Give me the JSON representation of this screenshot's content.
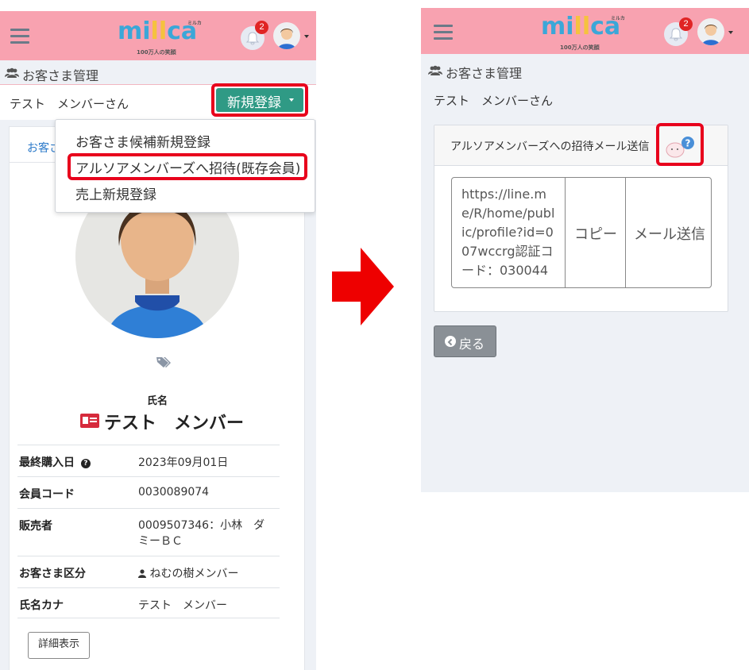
{
  "left": {
    "logo": {
      "text": "millca",
      "sub": "100万人の笑顔",
      "tag": "ミルカ"
    },
    "notification_count": "2",
    "breadcrumb": "お客さま管理",
    "customer_title": "テスト　メンバーさん",
    "new_button_label": "新規登録",
    "dropdown": {
      "items": [
        "お客さま候補新規登録",
        "アルソアメンバーズへ招待(既存会員)",
        "売上新規登録"
      ]
    },
    "card_tab": "お客さ",
    "name_caption": "氏名",
    "name": "テスト　メンバー",
    "rows": [
      {
        "label": "最終購入日",
        "value": "2023年09月01日"
      },
      {
        "label": "会員コード",
        "value": "0030089074"
      },
      {
        "label": "販売者",
        "value": "0009507346：小林　ダミーＢＣ"
      },
      {
        "label": "お客さま区分",
        "value": "ねむの樹メンバー"
      },
      {
        "label": "氏名カナ",
        "value": "テスト　メンバー"
      }
    ],
    "detail_button": "詳細表示"
  },
  "right": {
    "logo": {
      "text": "millca",
      "sub": "100万人の笑顔",
      "tag": "ミルカ"
    },
    "notification_count": "2",
    "breadcrumb": "お客さま管理",
    "customer_title": "テスト　メンバーさん",
    "invite_title": "アルソアメンバーズへの招待メール送信",
    "invite_text": "https://line.me/R/home/public/profile?id=007wccrg認証コード：030044",
    "copy_button": "コピー",
    "mail_button": "メール送信",
    "back_button": "戻る"
  },
  "colors": {
    "navbar": "#f8a2b0",
    "accent_green": "#2f9a85",
    "highlight_red": "#e8001c",
    "badge_red": "#e02424",
    "link_blue": "#2b79c9"
  }
}
